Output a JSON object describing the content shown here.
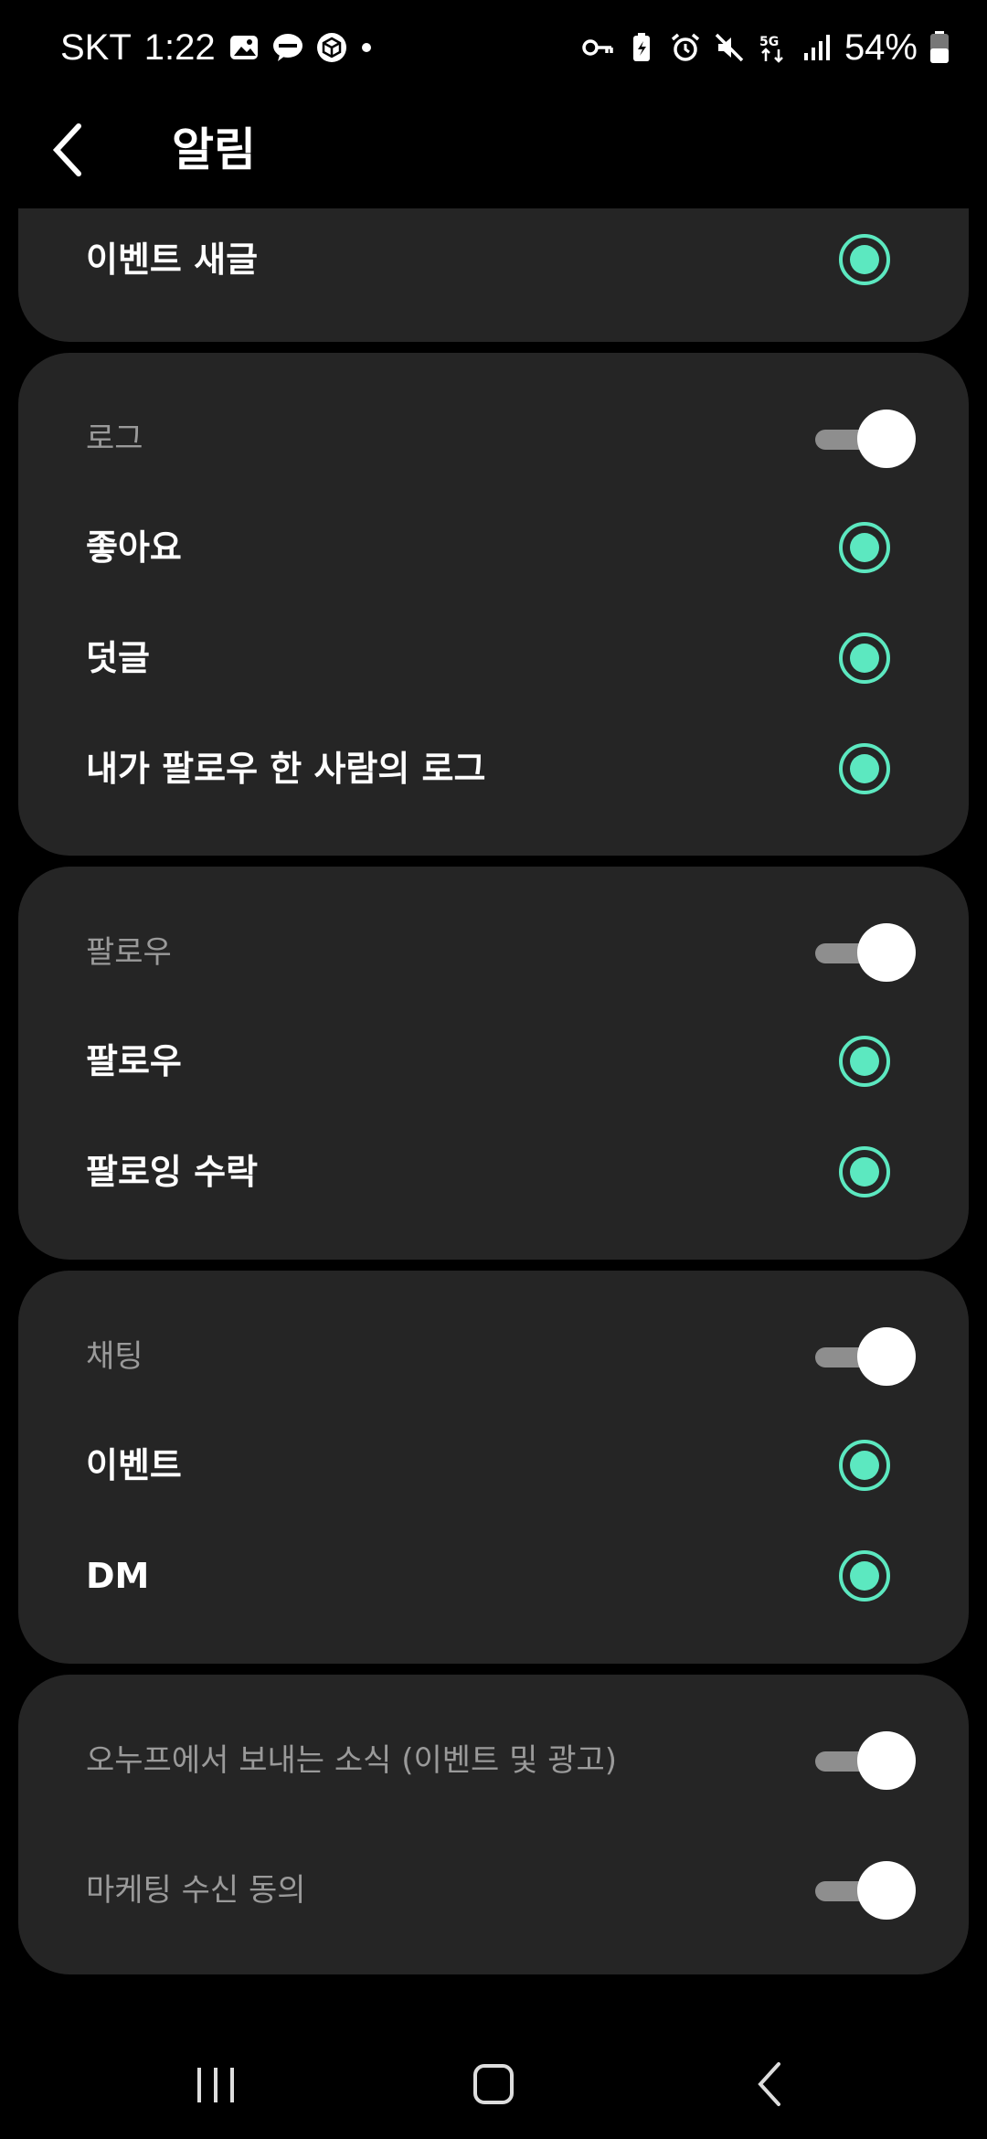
{
  "status": {
    "carrier": "SKT",
    "time": "1:22",
    "battery": "54%"
  },
  "header": {
    "title": "알림"
  },
  "cards": {
    "top": {
      "item": "이벤트 새글"
    },
    "log": {
      "section": "로그",
      "items": [
        "좋아요",
        "덧글",
        "내가 팔로우 한 사람의 로그"
      ]
    },
    "follow": {
      "section": "팔로우",
      "items": [
        "팔로우",
        "팔로잉 수락"
      ]
    },
    "chat": {
      "section": "채팅",
      "items": [
        "이벤트",
        "DM"
      ]
    },
    "marketing": {
      "items": [
        "오누프에서 보내는 소식 (이벤트 및 광고)",
        "마케팅 수신 동의"
      ]
    }
  },
  "colors": {
    "accent": "#5ce8c0",
    "card_bg": "#252525",
    "background": "#000000"
  }
}
